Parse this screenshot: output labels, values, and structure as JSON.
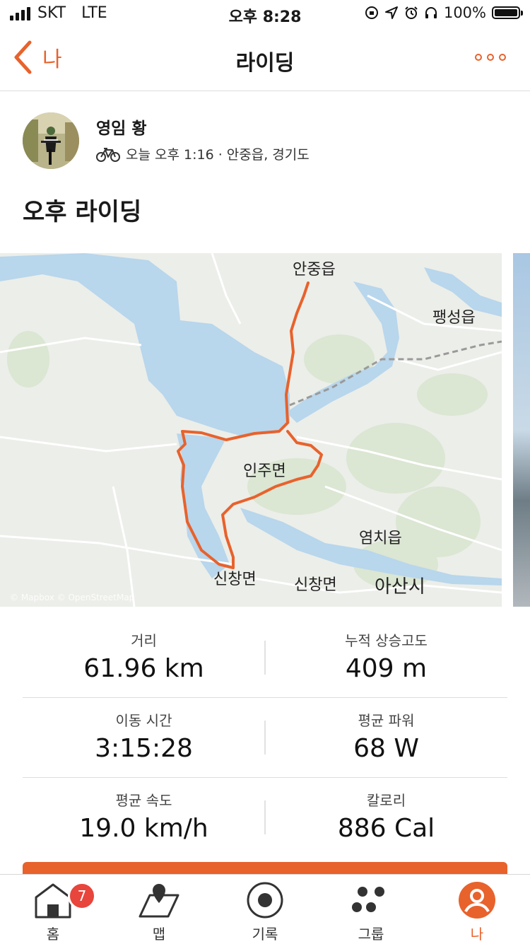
{
  "status_bar": {
    "carrier": "SKT",
    "network": "LTE",
    "time": "오후 8:28",
    "battery": "100%"
  },
  "nav": {
    "back_label": "나",
    "title": "라이딩"
  },
  "activity": {
    "athlete_name": "영임 황",
    "meta": "오늘 오후 1:16 · 안중읍, 경기도",
    "title": "오후 라이딩"
  },
  "map": {
    "labels": {
      "anjung": "안중읍",
      "paengseong": "팽성읍",
      "inju": "인주면",
      "yeomchi": "염치읍",
      "sinchang_a": "신창면",
      "sinchang_b": "신창면",
      "asan": "아산시"
    },
    "attribution": "© Mapbox © OpenStreetMap",
    "route_color": "#e8622c",
    "water_color": "#b8d6ec"
  },
  "stats": [
    {
      "label": "거리",
      "value": "61.96 km"
    },
    {
      "label": "누적 상승고도",
      "value": "409 m"
    },
    {
      "label": "이동 시간",
      "value": "3:15:28"
    },
    {
      "label": "평균 파워",
      "value": "68 W"
    },
    {
      "label": "평균 속도",
      "value": "19.0 km/h"
    },
    {
      "label": "칼로리",
      "value": "886 Cal"
    }
  ],
  "tabs": [
    {
      "label": "홈",
      "icon": "home-icon",
      "badge": "7"
    },
    {
      "label": "맵",
      "icon": "map-icon"
    },
    {
      "label": "기록",
      "icon": "record-icon"
    },
    {
      "label": "그룹",
      "icon": "groups-icon"
    },
    {
      "label": "나",
      "icon": "profile-icon",
      "active": true
    }
  ],
  "colors": {
    "accent": "#e8622c",
    "badge": "#e8453c"
  }
}
